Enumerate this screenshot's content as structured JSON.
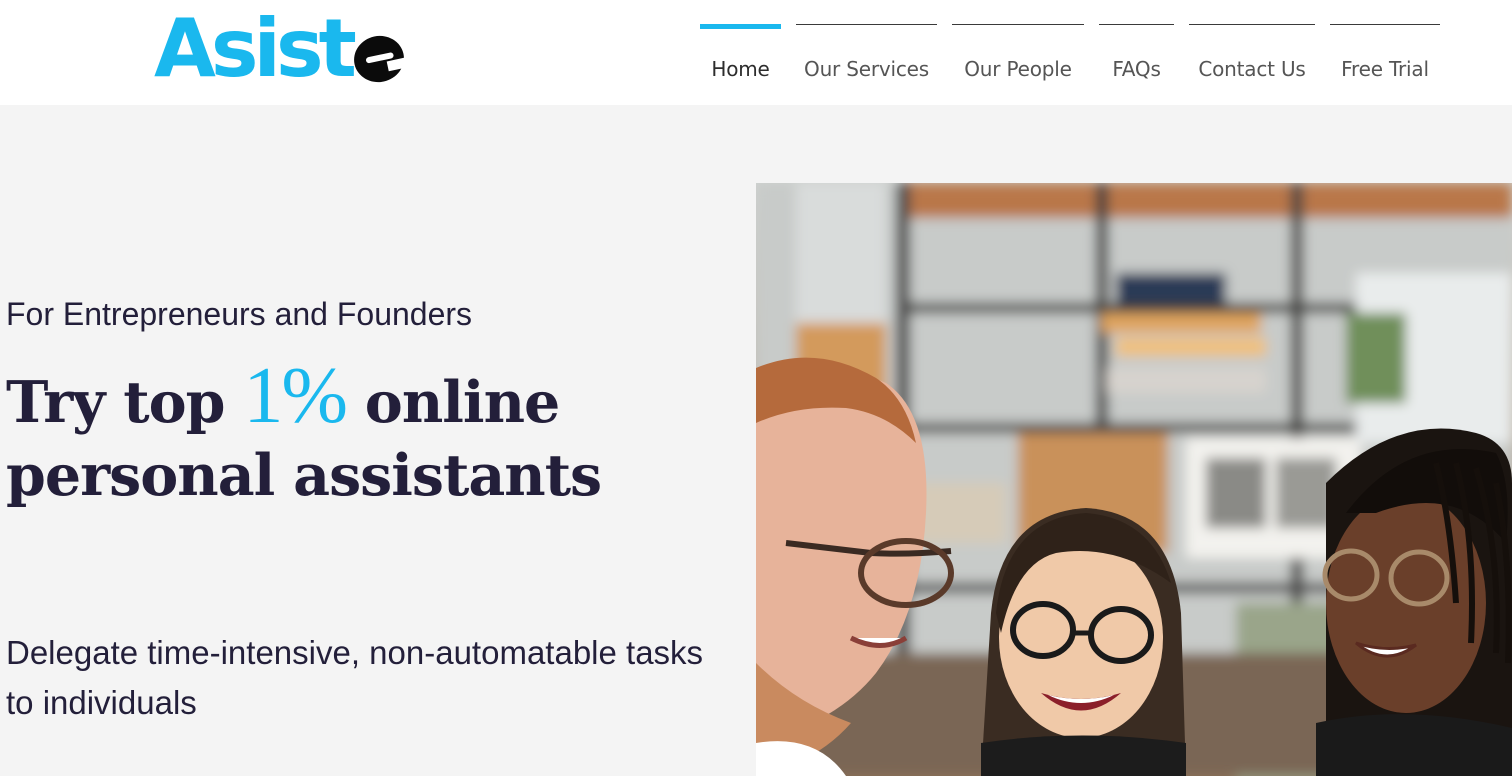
{
  "brand": {
    "logo_text": "Asist",
    "logo_name": "Asistee"
  },
  "nav": {
    "items": [
      {
        "label": "Home",
        "active": true
      },
      {
        "label": "Our Services",
        "active": false
      },
      {
        "label": "Our People",
        "active": false
      },
      {
        "label": "FAQs",
        "active": false
      },
      {
        "label": "Contact Us",
        "active": false
      },
      {
        "label": "Free Trial",
        "active": false
      }
    ]
  },
  "hero": {
    "subtitle": "For Entrepreneurs and Founders",
    "title_before": "Try top ",
    "title_accent": "1%",
    "title_after": " online personal assistants",
    "description": "Delegate time-intensive, non-automatable tasks to individuals"
  },
  "colors": {
    "accent": "#1ab8ee",
    "text": "#231f3a",
    "background": "#f4f4f4"
  }
}
